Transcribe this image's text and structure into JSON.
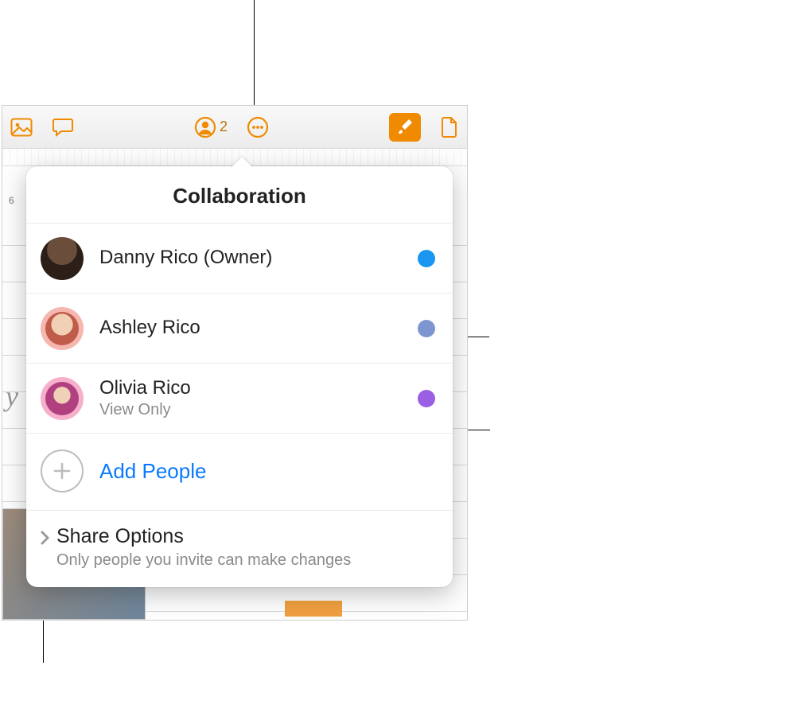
{
  "toolbar": {
    "collaborator_count": "2",
    "ruler_number": "6"
  },
  "popover": {
    "title": "Collaboration",
    "participants": [
      {
        "name": "Danny Rico (Owner)",
        "sub": "",
        "dot_color": "#1996f0",
        "avatar": "danny"
      },
      {
        "name": "Ashley Rico",
        "sub": "",
        "dot_color": "#7d96cf",
        "avatar": "ashley"
      },
      {
        "name": "Olivia Rico",
        "sub": "View Only",
        "dot_color": "#9a5fe3",
        "avatar": "olivia"
      }
    ],
    "add_people_label": "Add People",
    "share_options": {
      "title": "Share Options",
      "subtitle": "Only people you invite can make changes"
    }
  },
  "background_document": {
    "script_text": "y"
  }
}
